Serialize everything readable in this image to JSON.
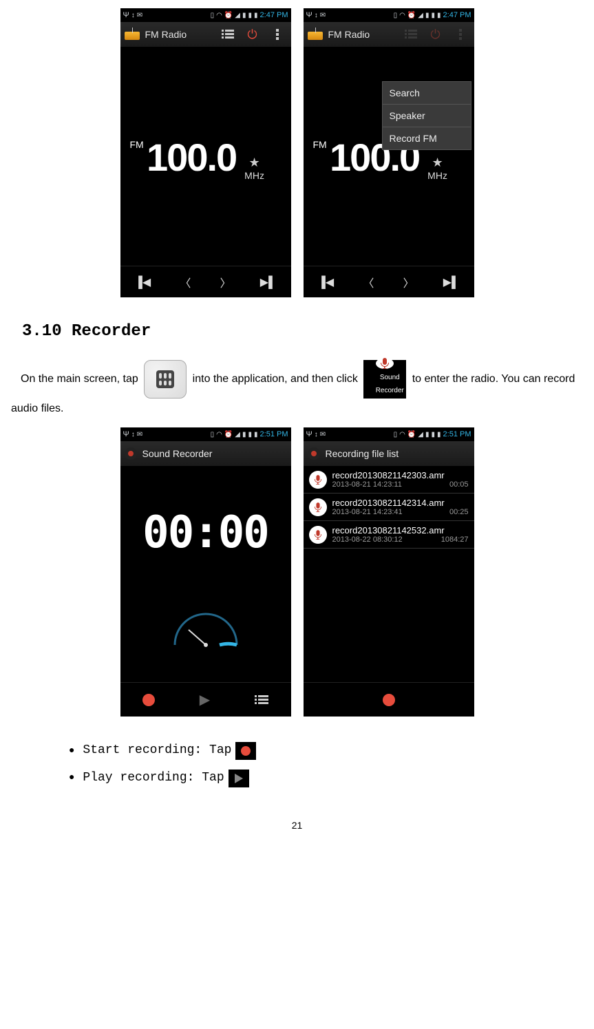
{
  "status": {
    "clock": "2:47 PM",
    "clock2": "2:51 PM"
  },
  "fm": {
    "title": "FM Radio",
    "band": "FM",
    "freq": "100.0",
    "unit": "MHz",
    "menu": {
      "search": "Search",
      "speaker": "Speaker",
      "recordfm": "Record FM"
    }
  },
  "section": {
    "heading": "3.10 Recorder",
    "para_before": "On the main screen, tap",
    "para_mid": "into the application, and then click",
    "para_after": "to enter the radio. You can record audio files.",
    "recorder_label_1": "Sound",
    "recorder_label_2": "Recorder"
  },
  "recorder": {
    "title": "Sound Recorder",
    "time": "00:00",
    "list_title": "Recording file list",
    "files": [
      {
        "name": "record20130821142303.amr",
        "date": "2013-08-21 14:23:11",
        "dur": "00:05"
      },
      {
        "name": "record20130821142314.amr",
        "date": "2013-08-21 14:23:41",
        "dur": "00:25"
      },
      {
        "name": "record20130821142532.amr",
        "date": "2013-08-22 08:30:12",
        "dur": "1084:27"
      }
    ]
  },
  "bullets": {
    "start": "Start recording: Tap",
    "play": "Play recording: Tap"
  },
  "page_number": "21"
}
